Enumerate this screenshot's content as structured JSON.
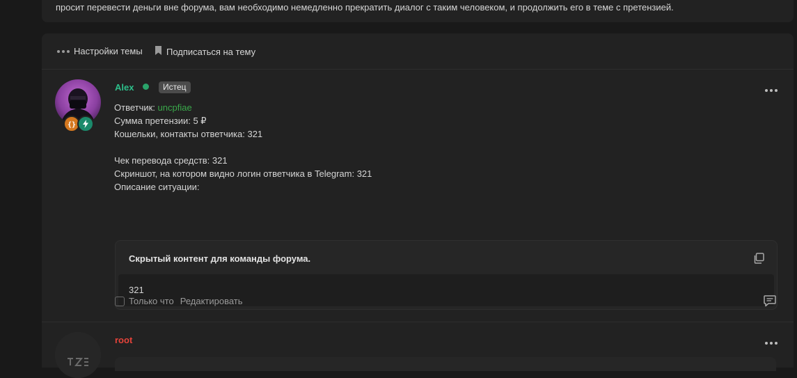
{
  "notice": {
    "text": "просит перевести деньги вне форума, вам необходимо немедленно прекратить диалог с таким человеком, и продолжить его в теме с претензией."
  },
  "thread_tools": {
    "settings_label": "Настройки темы",
    "subscribe_label": "Подписаться на тему"
  },
  "posts": [
    {
      "username": "Alex",
      "online": true,
      "role": "Истец",
      "lines": {
        "respondent_label": "Ответчик: ",
        "respondent_value": "uncpfiae",
        "claim_amount": "Сумма претензии: 5 ₽",
        "wallets": "Кошельки, контакты ответчика: 321",
        "receipt": "Чек перевода средств: 321",
        "screenshot": "Скриншот, на котором видно логин ответчика в Telegram: 321",
        "description": "Описание ситуации:"
      },
      "hidden": {
        "title": "Скрытый контент для команды форума.",
        "body": "321"
      },
      "footer": {
        "time": "Только что",
        "edit": "Редактировать"
      }
    },
    {
      "username": "root"
    }
  ],
  "colors": {
    "background": "#191919",
    "panel": "#222222",
    "username_alex": "#2dbf8a",
    "username_root": "#e5433a",
    "link_green": "#3aa84a"
  },
  "icons": [
    "more-dots-icon",
    "bookmark-icon",
    "copy-icon",
    "reply-icon",
    "code-badge-icon",
    "lightning-badge-icon"
  ]
}
